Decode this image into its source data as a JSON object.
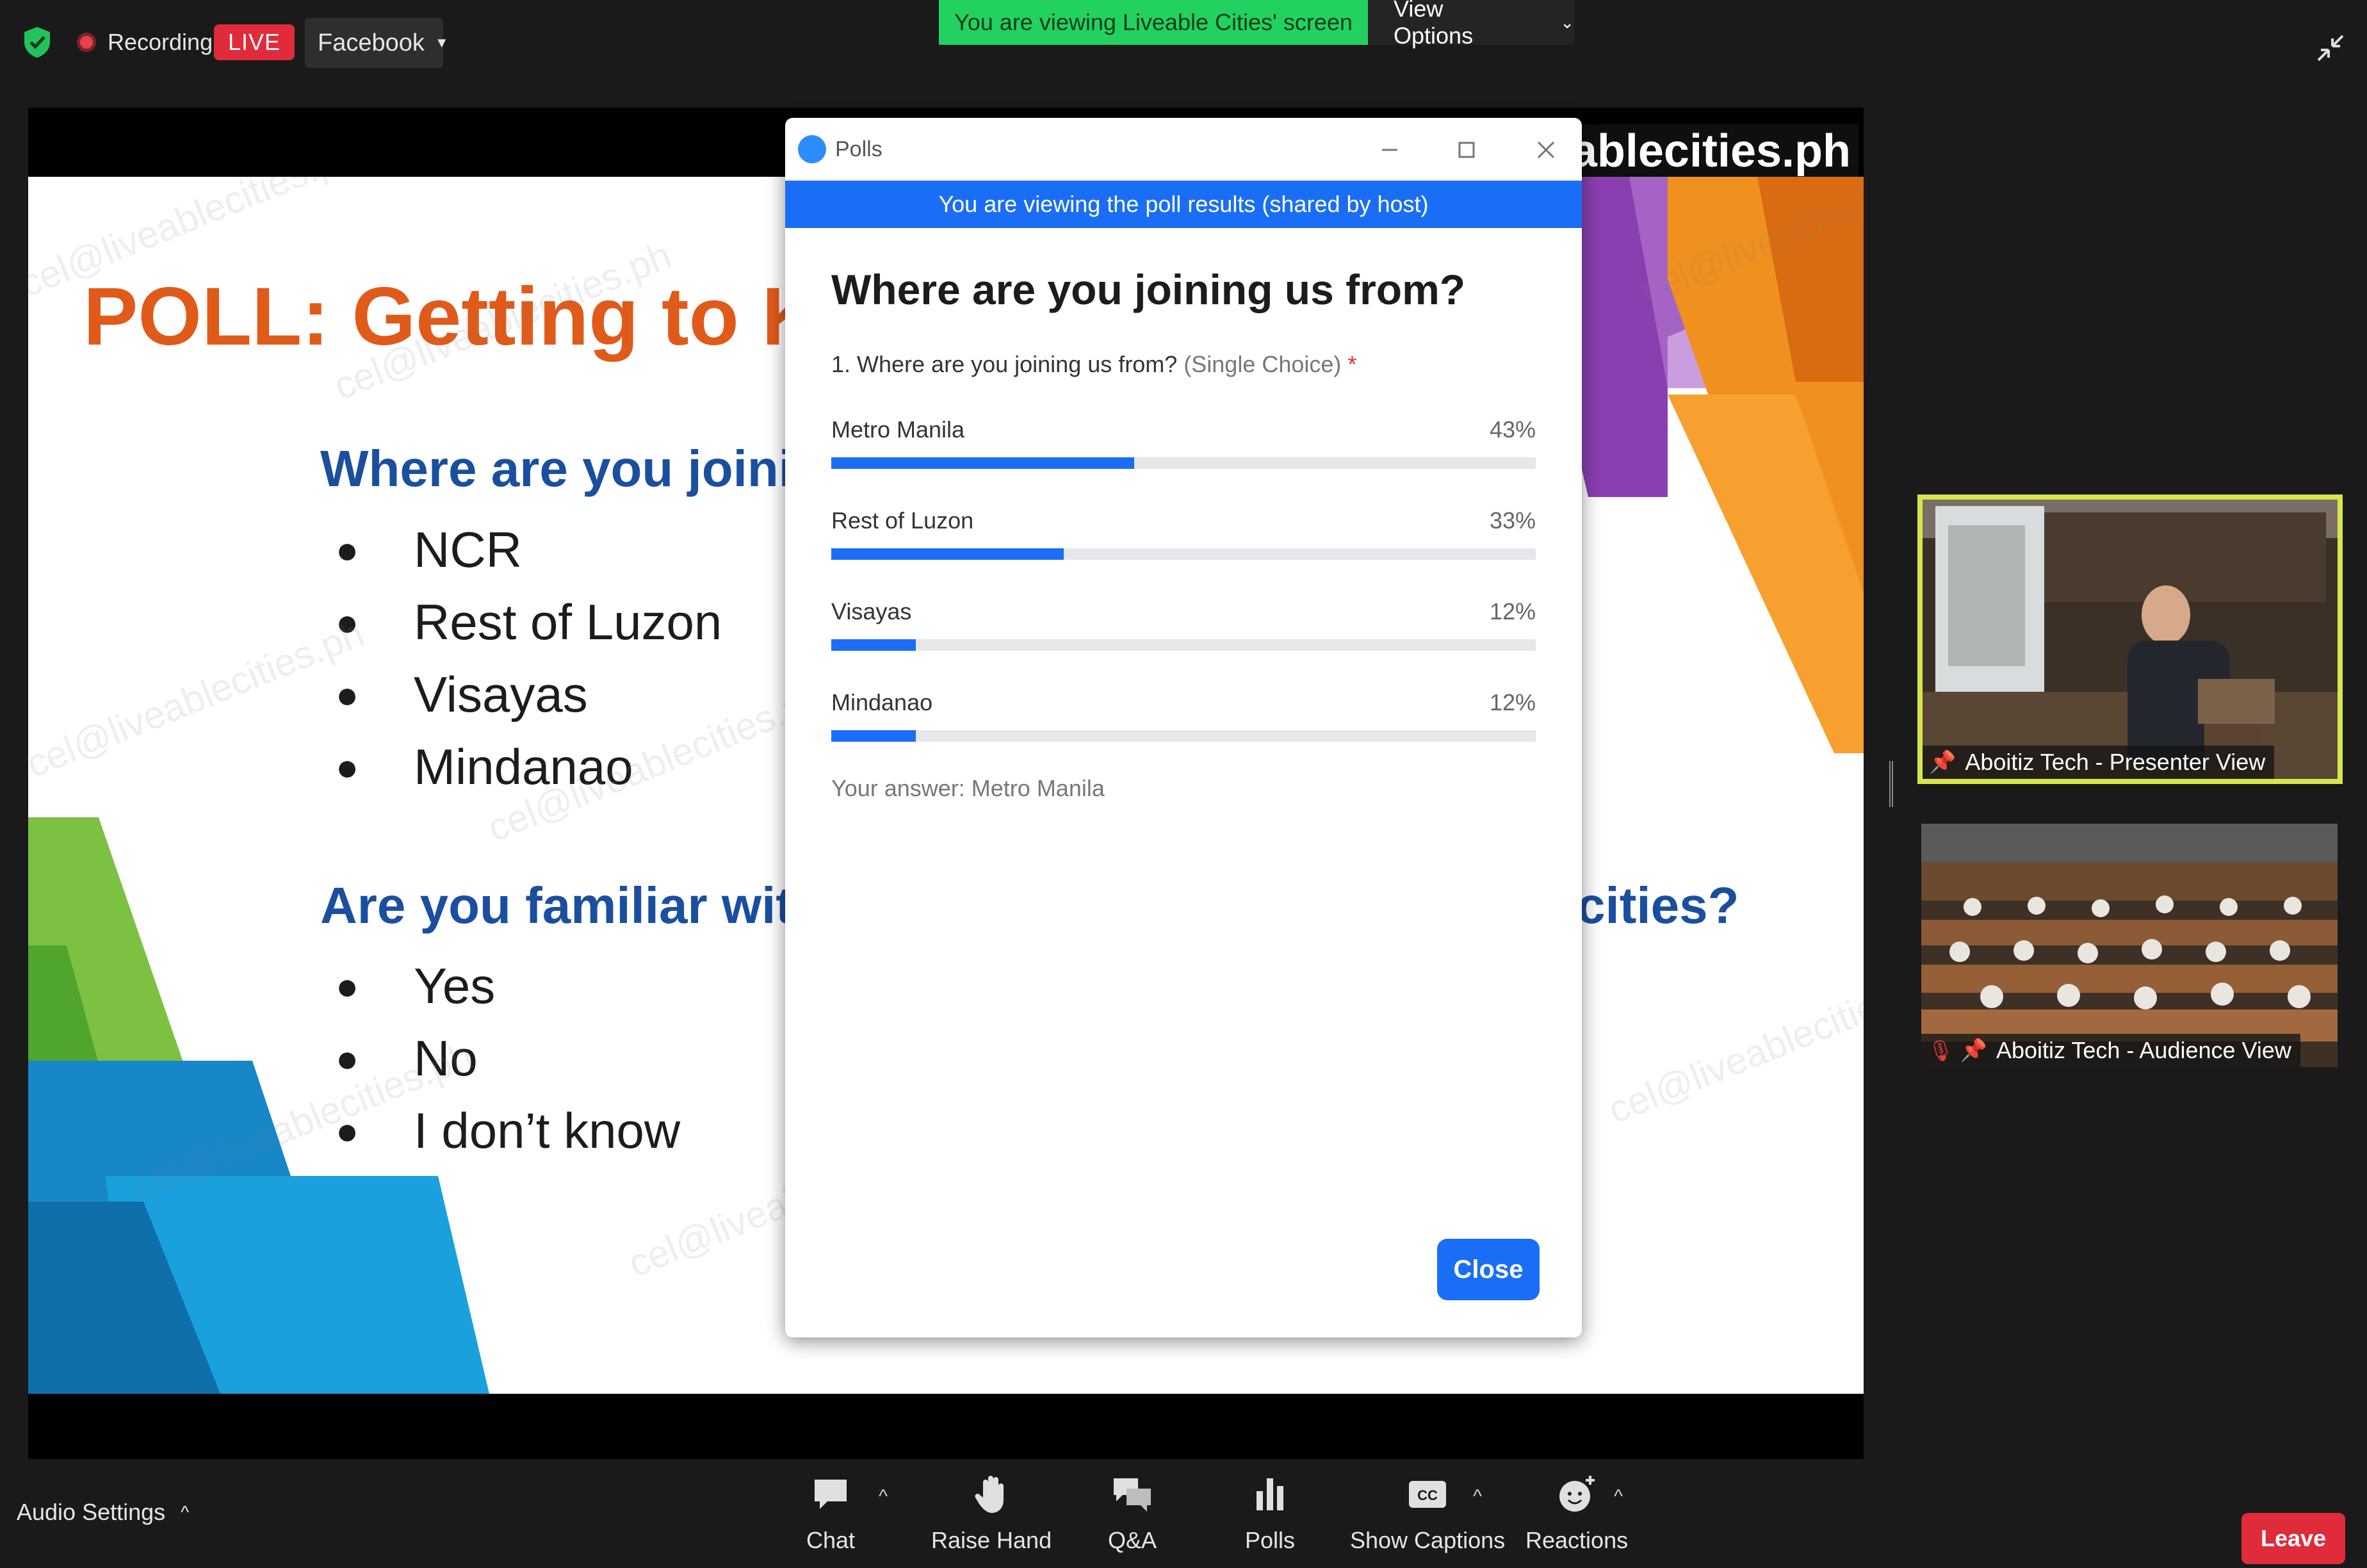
{
  "topbar": {
    "recording_label": "Recording",
    "live_label": "LIVE",
    "stream_target": "Facebook",
    "viewing_banner": "You are viewing Liveable Cities' screen",
    "view_options": "View Options"
  },
  "slide": {
    "site_text": "eablecities.ph",
    "title": "POLL: Getting to Kn",
    "question1": "Where are you joining u",
    "bullets1": [
      "NCR",
      "Rest of Luzon",
      "Visayas",
      "Mindanao"
    ],
    "question2": "Are you familiar with ho",
    "question2_end": "cities?",
    "bullets2": [
      "Yes",
      "No",
      "I don’t know"
    ],
    "watermark": "cel@liveablecities.ph"
  },
  "polls": {
    "window_title": "Polls",
    "banner": "You are viewing the poll results (shared by host)",
    "heading": "Where are you joining us from?",
    "question": "1. Where are you joining us from?",
    "choice_type": "(Single Choice)",
    "required_mark": "*",
    "options": [
      {
        "label": "Metro Manila",
        "percent": "43%",
        "value": 0.43
      },
      {
        "label": "Rest of Luzon",
        "percent": "33%",
        "value": 0.33
      },
      {
        "label": "Visayas",
        "percent": "12%",
        "value": 0.12
      },
      {
        "label": "Mindanao",
        "percent": "12%",
        "value": 0.12
      }
    ],
    "your_answer": "Your answer: Metro Manila",
    "close_label": "Close"
  },
  "videos": {
    "presenter_label": "Aboitiz Tech - Presenter View",
    "audience_label": "Aboitiz Tech - Audience View"
  },
  "toolbar": {
    "audio_settings": "Audio Settings",
    "chat": "Chat",
    "raise_hand": "Raise Hand",
    "qa": "Q&A",
    "polls": "Polls",
    "show_captions": "Show Captions",
    "reactions": "Reactions",
    "leave": "Leave"
  },
  "colors": {
    "accent_blue": "#1a6ef5",
    "live_red": "#e02b3a",
    "viewing_green": "#23d160",
    "slide_title_orange": "#e05a1a",
    "slide_heading_blue": "#1a4fa0",
    "active_speaker_border": "#d7e64a"
  }
}
